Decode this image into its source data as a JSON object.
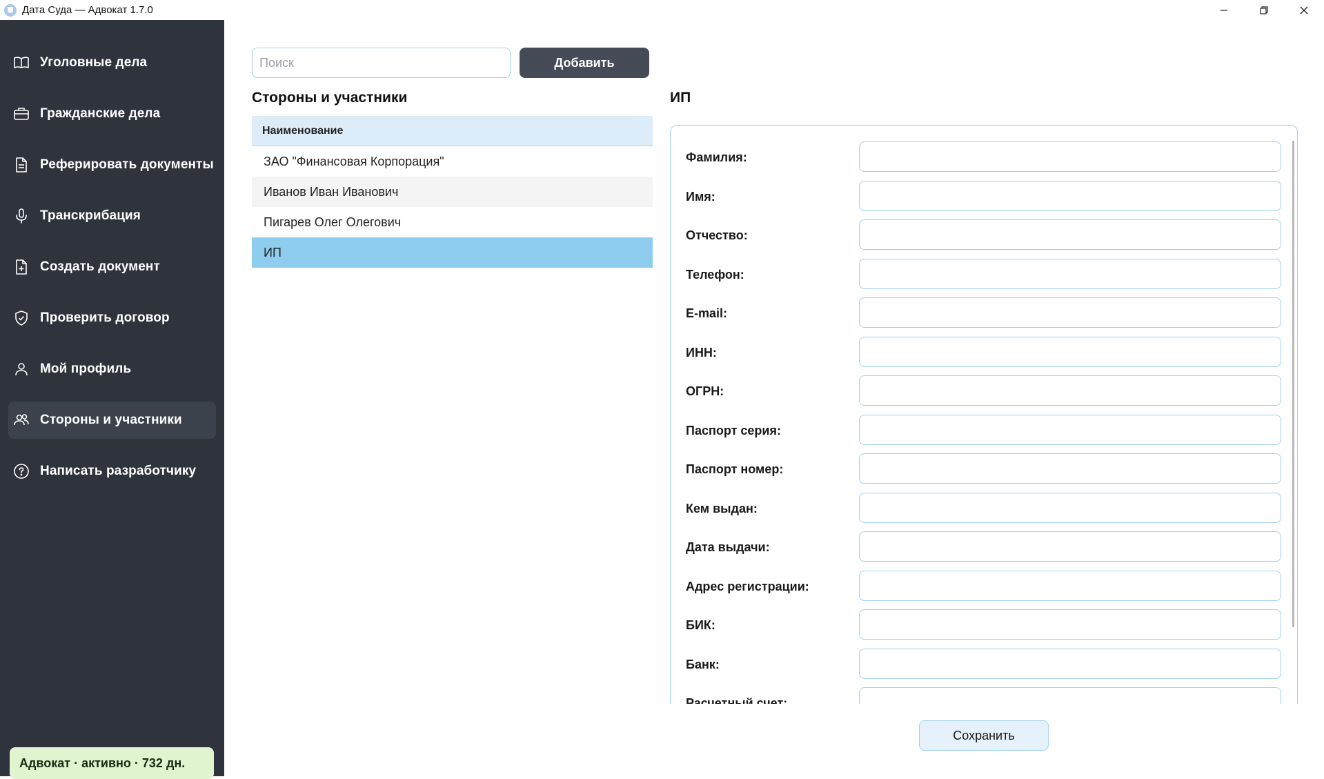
{
  "window": {
    "title": "Дата Суда — Адвокат 1.7.0",
    "controls": [
      "minimize-icon",
      "restore-icon",
      "close-icon"
    ]
  },
  "sidebar": {
    "items": [
      {
        "label": "Уголовные дела",
        "icon": "book-open-icon"
      },
      {
        "label": "Гражданские дела",
        "icon": "briefcase-icon"
      },
      {
        "label": "Реферировать документы",
        "icon": "document-lines-icon"
      },
      {
        "label": "Транскрибация",
        "icon": "microphone-icon"
      },
      {
        "label": "Создать документ",
        "icon": "document-add-icon"
      },
      {
        "label": "Проверить договор",
        "icon": "shield-check-icon"
      },
      {
        "label": "Мой профиль",
        "icon": "user-icon"
      },
      {
        "label": "Стороны и участники",
        "icon": "users-icon",
        "active": true
      },
      {
        "label": "Написать разработчику",
        "icon": "help-circle-icon"
      }
    ],
    "license": "Адвокат · активно · 732 дн."
  },
  "search": {
    "placeholder": "Поиск",
    "value": ""
  },
  "toolbar": {
    "add_label": "Добавить"
  },
  "list": {
    "title": "Стороны и участники",
    "column_header": "Наименование",
    "rows": [
      "ЗАО \"Финансовая Корпорация\"",
      "Иванов Иван Иванович",
      "Пигарев Олег Олегович",
      "ИП"
    ],
    "selected_index": 3
  },
  "form": {
    "title": "ИП",
    "fields": [
      {
        "label": "Фамилия:",
        "value": ""
      },
      {
        "label": "Имя:",
        "value": ""
      },
      {
        "label": "Отчество:",
        "value": ""
      },
      {
        "label": "Телефон:",
        "value": ""
      },
      {
        "label": "E-mail:",
        "value": ""
      },
      {
        "label": "ИНН:",
        "value": ""
      },
      {
        "label": "ОГРН:",
        "value": ""
      },
      {
        "label": "Паспорт серия:",
        "value": ""
      },
      {
        "label": "Паспорт номер:",
        "value": ""
      },
      {
        "label": "Кем выдан:",
        "value": ""
      },
      {
        "label": "Дата выдачи:",
        "value": ""
      },
      {
        "label": "Адрес регистрации:",
        "value": ""
      },
      {
        "label": "БИК:",
        "value": ""
      },
      {
        "label": "Банк:",
        "value": ""
      },
      {
        "label": "Расчетный счет:",
        "value": ""
      }
    ],
    "save_label": "Сохранить"
  },
  "colors": {
    "sidebar_bg": "#2f343c",
    "accent_border": "#9ed0ec",
    "selected_row": "#8fcdef",
    "license_bg": "#dff4cf",
    "add_button_bg": "#454c57"
  }
}
